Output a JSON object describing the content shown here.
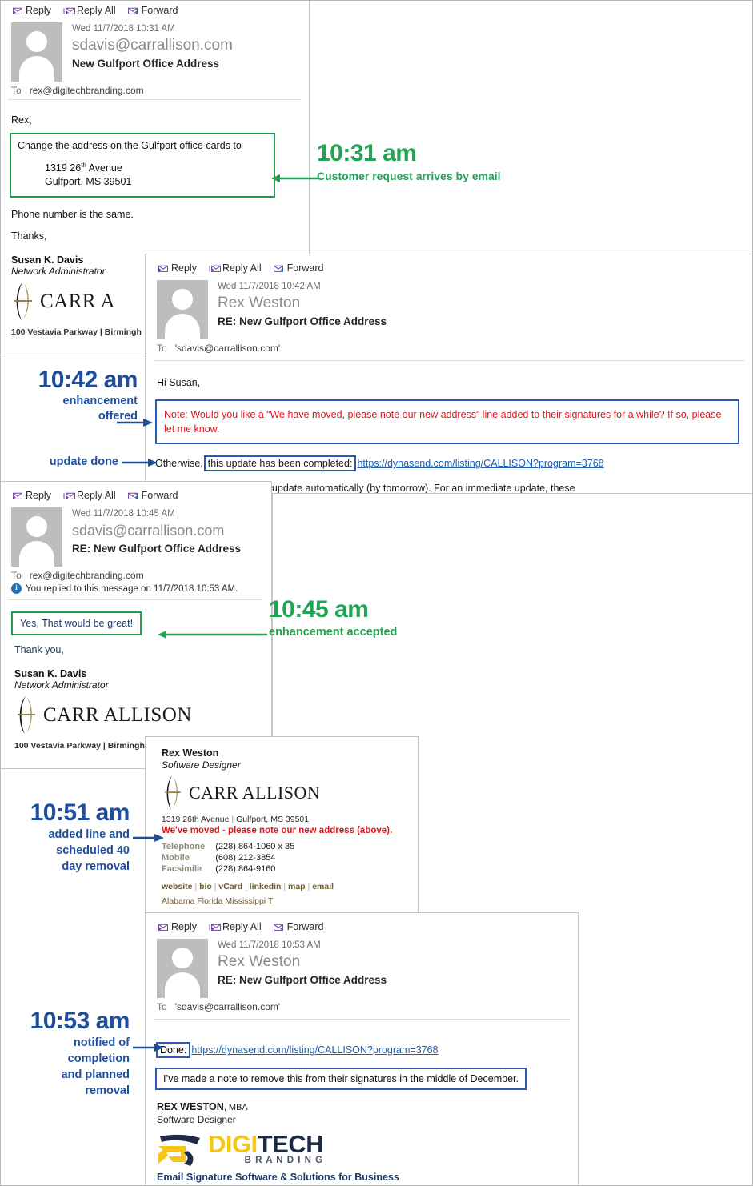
{
  "commands": {
    "reply": "Reply",
    "reply_all": "Reply All",
    "forward": "Forward"
  },
  "emails": {
    "e1": {
      "date": "Wed 11/7/2018 10:31 AM",
      "from": "sdavis@carrallison.com",
      "subject": "New Gulfport Office Address",
      "to_label": "To",
      "to": "rex@digitechbranding.com",
      "greeting": "Rex,",
      "request_line": "Change the address on the Gulfport office cards to",
      "address_line1": "1319 26",
      "address_sup": "th",
      "address_line1_rest": " Avenue",
      "address_line2": "Gulfport, MS  39501",
      "phone_note": "Phone number is the same.",
      "closing": "Thanks,",
      "sig_name": "Susan K. Davis",
      "sig_title": "Network Administrator",
      "logo_text": "CARR A",
      "sig_address_clipped": "100 Vestavia Parkway | Birmingh"
    },
    "e2": {
      "date": "Wed 11/7/2018 10:42 AM",
      "from": "Rex Weston",
      "subject": "RE: New Gulfport Office Address",
      "to_label": "To",
      "to": "'sdavis@carrallison.com'",
      "greeting": "Hi Susan,",
      "note_text": "Note: Would you like a “We have moved, please note our new address” line added to their signatures for a while?  If so, please let me know.",
      "otherwise_prefix": "Otherwise,",
      "otherwise_boxed": "this update has been completed:",
      "link": "https://dynasend.com/listing/CALLISON?program=3768",
      "clipped_line": "installed the signature will update automatically (by tomorrow).  For an immediate update, these",
      "clipped_link": "these"
    },
    "e3": {
      "date": "Wed 11/7/2018 10:45 AM",
      "from": "sdavis@carrallison.com",
      "subject": "RE: New Gulfport Office Address",
      "to_label": "To",
      "to": "rex@digitechbranding.com",
      "reply_info": "You replied to this message on 11/7/2018 10:53 AM.",
      "quote": "Yes, That would be great!",
      "thanks": "Thank you,",
      "sig_name": "Susan K. Davis",
      "sig_title": "Network Administrator",
      "logo_text": "CARR ALLISON",
      "sig_address_clipped": "100 Vestavia Parkway | Birmingh"
    },
    "card": {
      "name": "Rex Weston",
      "title": "Software Designer",
      "logo_text": "CARR ALLISON",
      "address": "1319 26th Avenue",
      "address_city": "Gulfport, MS 39501",
      "moved_note": "We've moved - please note our new address (above).",
      "phones": [
        {
          "label": "Telephone",
          "value": "(228) 864-1060 x 35"
        },
        {
          "label": "Mobile",
          "value": "(608) 212-3854"
        },
        {
          "label": "Facsimile",
          "value": "(228) 864-9160"
        }
      ],
      "links": [
        "website",
        "bio",
        "vCard",
        "linkedin",
        "map",
        "email"
      ],
      "clipped_states": "Alabama   Florida   Mississippi   T"
    },
    "e5": {
      "date": "Wed 11/7/2018 10:53 AM",
      "from": "Rex Weston",
      "subject": "RE: New Gulfport Office Address",
      "to_label": "To",
      "to": "'sdavis@carrallison.com'",
      "done_label": "Done:",
      "link": "https://dynasend.com/listing/CALLISON?program=3768",
      "note": "I’ve made a note to remove this from their signatures in the middle of December.",
      "sig_name": "REX WESTON",
      "sig_name_suffix": ", MBA",
      "sig_title": "Software Designer",
      "logo_digi": "DIGI",
      "logo_tech": "TECH",
      "logo_branding": "B R A N D I N G",
      "tagline_clipped": "Email Signature Software & Solutions for Business"
    }
  },
  "annotations": [
    {
      "time": "10:31 am",
      "lines": [
        "Customer request arrives by email"
      ],
      "color": "#23a455"
    },
    {
      "time": "10:42 am",
      "lines": [
        "enhancement",
        "offered"
      ],
      "color": "#1f4e9c"
    },
    {
      "time": "",
      "lines": [
        "update done"
      ],
      "color": "#1f4e9c"
    },
    {
      "time": "10:45 am",
      "lines": [
        "enhancement accepted"
      ],
      "color": "#23a455"
    },
    {
      "time": "10:51 am",
      "lines": [
        "added line and",
        "scheduled 40",
        "day removal"
      ],
      "color": "#1f4e9c"
    },
    {
      "time": "10:53 am",
      "lines": [
        "notified of",
        "completion",
        "and planned",
        "removal"
      ],
      "color": "#1f4e9c"
    }
  ],
  "colors": {
    "green": "#23a455",
    "blue": "#1f4e9c",
    "red": "#e8131a",
    "link": "#1d5fb0",
    "digitech_yellow": "#f5c518",
    "digitech_navy": "#1d2a44"
  }
}
